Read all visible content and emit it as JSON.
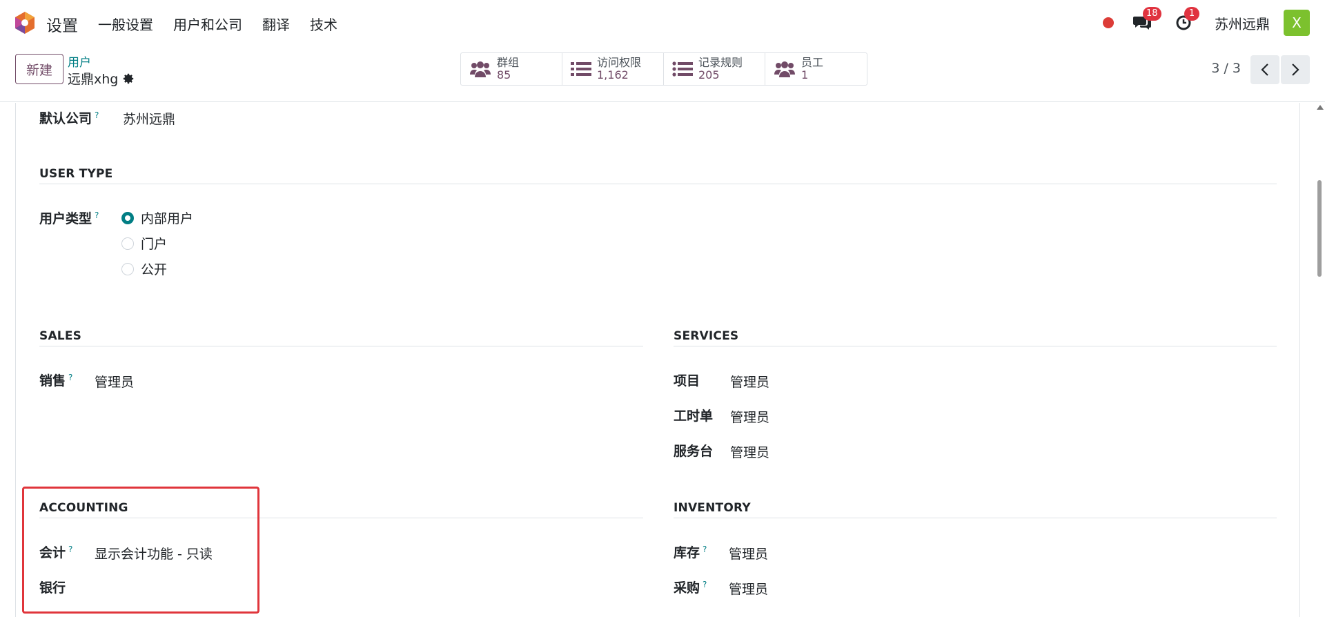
{
  "navbar": {
    "app_title": "设置",
    "menu": [
      "一般设置",
      "用户和公司",
      "翻译",
      "技术"
    ],
    "messages_count": "18",
    "activities_count": "1",
    "company": "苏州远鼎",
    "avatar_letter": "X"
  },
  "control_panel": {
    "new_label": "新建",
    "breadcrumb_parent": "用户",
    "breadcrumb_current": "远鼎xhg",
    "smart_buttons": [
      {
        "label": "群组",
        "value": "85",
        "icon": "users-icon"
      },
      {
        "label": "访问权限",
        "value": "1,162",
        "icon": "list-icon"
      },
      {
        "label": "记录规则",
        "value": "205",
        "icon": "list-icon"
      },
      {
        "label": "员工",
        "value": "1",
        "icon": "users-icon"
      }
    ],
    "pager": "3 / 3"
  },
  "form": {
    "default_company": {
      "label": "默认公司",
      "help": "?",
      "value": "苏州远鼎"
    },
    "user_type_section": "USER TYPE",
    "user_type": {
      "label": "用户类型",
      "help": "?",
      "options": [
        "内部用户",
        "门户",
        "公开"
      ],
      "selected": "内部用户"
    },
    "sales": {
      "title": "SALES",
      "fields": [
        {
          "label": "销售",
          "help": "?",
          "value": "管理员"
        }
      ]
    },
    "services": {
      "title": "SERVICES",
      "fields": [
        {
          "label": "项目",
          "value": "管理员"
        },
        {
          "label": "工时单",
          "value": "管理员"
        },
        {
          "label": "服务台",
          "value": "管理员"
        }
      ]
    },
    "accounting": {
      "title": "ACCOUNTING",
      "fields": [
        {
          "label": "会计",
          "help": "?",
          "value": "显示会计功能 - 只读"
        },
        {
          "label": "银行",
          "value": ""
        }
      ]
    },
    "inventory": {
      "title": "INVENTORY",
      "fields": [
        {
          "label": "库存",
          "help": "?",
          "value": "管理员"
        },
        {
          "label": "采购",
          "help": "?",
          "value": "管理员"
        }
      ]
    }
  },
  "colors": {
    "brand": "#714b67",
    "accent": "#017e84",
    "badge": "#e0333f",
    "highlight": "#e0353b"
  }
}
